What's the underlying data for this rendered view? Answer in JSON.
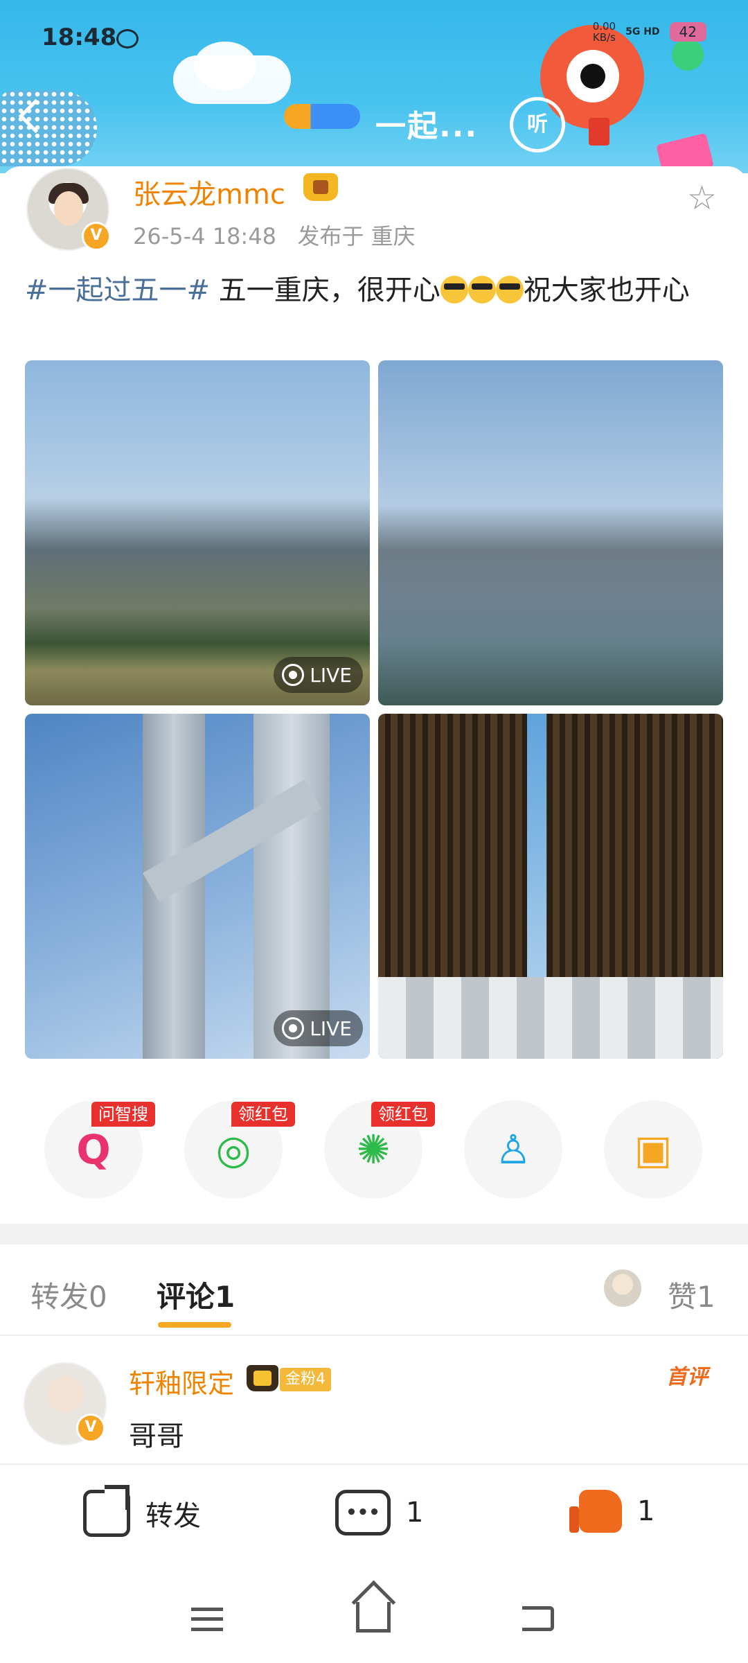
{
  "status_bar": {
    "time": "18:48",
    "net_speed_value": "0.00",
    "net_speed_unit": "KB/s",
    "network": "5G HD",
    "battery": "42"
  },
  "header": {
    "topic_title": "一起...",
    "listen_label": "听"
  },
  "post": {
    "author": "张云龙mmc",
    "verified_label": "V",
    "timestamp": "26-5-4 18:48",
    "location_prefix": "发布于",
    "location": "重庆",
    "hashtag": "#一起过五一#",
    "text_main": " 五一重庆，很开心",
    "text_tail": "祝大家也开心",
    "photos": [
      {
        "live": true,
        "live_label": "LIVE"
      },
      {
        "live": false
      },
      {
        "live": true,
        "live_label": "LIVE"
      },
      {
        "live": false
      }
    ]
  },
  "share_row": [
    {
      "icon": "search-ai-icon",
      "badge": "问智搜",
      "color": "#e8336f"
    },
    {
      "icon": "wechat-icon",
      "badge": "领红包",
      "color": "#2dba4a"
    },
    {
      "icon": "moments-icon",
      "badge": "领红包",
      "color": "#2dba4a"
    },
    {
      "icon": "qq-icon",
      "badge": "",
      "color": "#1da5e8"
    },
    {
      "icon": "save-image-icon",
      "badge": "",
      "color": "#f5a623"
    }
  ],
  "tabs": {
    "repost_label": "转发",
    "repost_count": "0",
    "comment_label": "评论",
    "comment_count": "1",
    "like_label": "赞",
    "like_count": "1"
  },
  "comment": {
    "author": "轩釉限定",
    "fan_badge": "金粉4",
    "text": "哥哥",
    "first_label": "首评"
  },
  "bottom_bar": {
    "forward_label": "转发",
    "comment_count": "1",
    "like_count": "1"
  },
  "colors": {
    "accent_orange": "#f08300",
    "tag_blue": "#4a6f99",
    "badge_red": "#e8302d",
    "like_orange": "#f06a1e"
  }
}
